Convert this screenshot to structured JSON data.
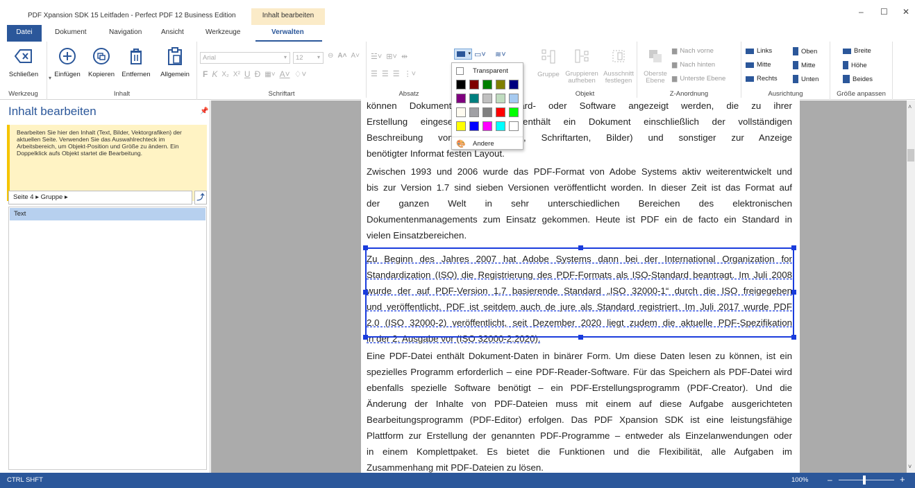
{
  "window": {
    "title": "PDF Xpansion SDK 15 Leitfaden - Perfect PDF 12 Business Edition",
    "context_tab": "Inhalt bearbeiten",
    "minimize": "–",
    "maximize": "☐",
    "close": "✕"
  },
  "tabs": [
    {
      "label": "Datei"
    },
    {
      "label": "Dokument"
    },
    {
      "label": "Navigation"
    },
    {
      "label": "Ansicht"
    },
    {
      "label": "Werkzeuge"
    },
    {
      "label": "Verwalten"
    }
  ],
  "ribbon": {
    "werkzeug": {
      "label": "Werkzeug",
      "close": "Schließen"
    },
    "inhalt": {
      "label": "Inhalt",
      "insert": "Einfügen",
      "copy": "Kopieren",
      "remove": "Entfernen",
      "general": "Allgemein"
    },
    "schriftart": {
      "label": "Schriftart",
      "font": "Arial",
      "size": "12",
      "bold": "F",
      "italic": "K"
    },
    "absatz": {
      "label": "Absatz"
    },
    "objekt": {
      "label": "Objekt",
      "group": "Gruppe",
      "ungroup": "Gruppieren aufheben",
      "crop": "Ausschnitt festlegen"
    },
    "zanordnung": {
      "label": "Z-Anordnung",
      "top": "Oberste Ebene",
      "forward": "Nach vorne",
      "backward": "Nach hinten",
      "bottom": "Unterste Ebene"
    },
    "ausrichtung": {
      "label": "Ausrichtung",
      "left": "Links",
      "center": "Mitte",
      "right": "Rechts",
      "top": "Oben",
      "middle": "Mitte",
      "bottom": "Unten"
    },
    "groesse": {
      "label": "Größe anpassen",
      "width": "Breite",
      "height": "Höhe",
      "both": "Beides"
    }
  },
  "color_popup": {
    "transparent": "Transparent",
    "other": "Andere",
    "colors": [
      "#000000",
      "#7f0000",
      "#007f00",
      "#7f7f00",
      "#00007f",
      "#7f007f",
      "#007f7f",
      "#c0c0c0",
      "#c0dcc0",
      "#a6caf0",
      "#fffbf0",
      "#a0a0a4",
      "#808080",
      "#ff0000",
      "#00ff00",
      "#ffff00",
      "#0000ff",
      "#ff00ff",
      "#00ffff",
      "#ffffff"
    ]
  },
  "left_panel": {
    "title": "Inhalt bearbeiten",
    "info": "Bearbeiten Sie hier den Inhalt (Text, Bilder, Vektorgrafiken) der aktuellen Seite. Verwenden Sie das Auswahlrechteck im Arbeitsbereich, um Objekt-Position und Größe zu ändern. Ein Doppelklick aufs Objekt startet die Bearbeitung.",
    "breadcrumb": "Seite 4 ▸ Gruppe ▸",
    "tree_item": "Text"
  },
  "document": {
    "para1": [
      "können Dokument               on der Hard- oder Software angezeigt werden, die zu ihrer",
      "Erstellung eingesetz              DF-Datei enthält ein Dokument einschließlich der vollständigen",
      "Beschreibung von                halt (Texte, Schriftarten, Bilder) und sonstiger zur Anzeige",
      "benötigter Informat                  festen Layout."
    ],
    "para2": [
      "Zwischen 1993 und 2006 wurde das PDF-Format von Adobe Systems aktiv weiterentwickelt und",
      "bis zur Version 1.7 sind sieben Versionen veröffentlicht worden. In dieser Zeit ist das Format auf",
      "der ganzen Welt in sehr unterschiedlichen Bereichen des elektronischen",
      "Dokumentenmanagements zum Einsatz gekommen. Heute ist PDF ein de facto ein Standard in",
      "vielen Einsatzbereichen."
    ],
    "para3": [
      "Zu Beginn des Jahres 2007 hat Adobe Systems dann bei der International Organization for",
      "Standardization (ISO) die Registrierung des PDF-Formats als ISO-Standard beantragt. Im Juli 2008",
      "wurde der auf PDF-Version 1.7 basierende Standard „ISO 32000-1“ durch die ISO freigegeben",
      "und veröffentlicht. PDF ist seitdem auch de jure als Standard registriert. Im Juli 2017 wurde PDF",
      "2.0 (ISO 32000-2) veröffentlicht, seit Dezember 2020 liegt zudem die aktuelle PDF-Spezifikation",
      "in der 2. Ausgabe vor (ISO 32000-2:2020)."
    ],
    "para4": [
      "Eine PDF-Datei enthält Dokument-Daten in binärer Form. Um diese Daten lesen zu können, ist ein",
      "spezielles Programm erforderlich – eine PDF-Reader-Software. Für das Speichern als PDF-Datei wird",
      "ebenfalls spezielle Software benötigt – ein PDF-Erstellungsprogramm (PDF-Creator). Und die",
      "Änderung der Inhalte von PDF-Dateien muss mit einem auf diese Aufgabe ausgerichteten",
      "Bearbeitungsprogramm (PDF-Editor) erfolgen. Das PDF Xpansion SDK ist eine leistungsfähige",
      "Plattform zur Erstellung der genannten PDF-Programme – entweder als Einzelanwendungen oder",
      "in einem Komplettpaket. Es bietet die Funktionen und die Flexibilität, alle Aufgaben im",
      "Zusammenhang mit PDF-Dateien zu lösen."
    ]
  },
  "status": {
    "keys": "CTRL  SHFT",
    "zoom": "100%",
    "minus": "–",
    "plus": "+"
  }
}
